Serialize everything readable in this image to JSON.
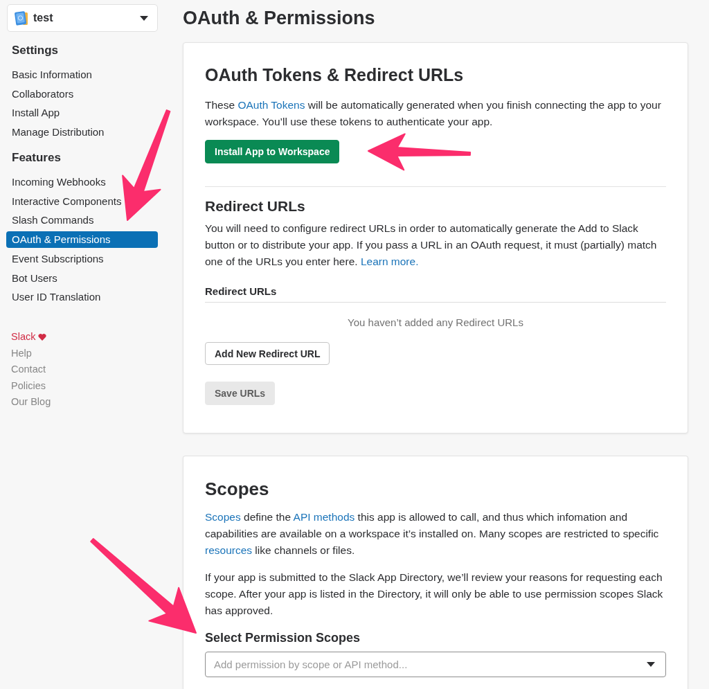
{
  "app_selector": {
    "name": "test"
  },
  "sidebar": {
    "sections": [
      {
        "heading": "Settings",
        "items": [
          {
            "label": "Basic Information",
            "selected": false
          },
          {
            "label": "Collaborators",
            "selected": false
          },
          {
            "label": "Install App",
            "selected": false
          },
          {
            "label": "Manage Distribution",
            "selected": false
          }
        ]
      },
      {
        "heading": "Features",
        "items": [
          {
            "label": "Incoming Webhooks",
            "selected": false
          },
          {
            "label": "Interactive Components",
            "selected": false
          },
          {
            "label": "Slash Commands",
            "selected": false
          },
          {
            "label": "OAuth & Permissions",
            "selected": true
          },
          {
            "label": "Event Subscriptions",
            "selected": false
          },
          {
            "label": "Bot Users",
            "selected": false
          },
          {
            "label": "User ID Translation",
            "selected": false
          }
        ]
      }
    ],
    "footer_links": [
      {
        "label": "Slack",
        "kind": "brand"
      },
      {
        "label": "Help",
        "kind": "link"
      },
      {
        "label": "Contact",
        "kind": "link"
      },
      {
        "label": "Policies",
        "kind": "link"
      },
      {
        "label": "Our Blog",
        "kind": "link"
      }
    ]
  },
  "page_title": "OAuth & Permissions",
  "oauth_card": {
    "title": "OAuth Tokens & Redirect URLs",
    "description": [
      {
        "kind": "text",
        "text": "These "
      },
      {
        "kind": "link",
        "text": "OAuth Tokens"
      },
      {
        "kind": "text",
        "text": " will be automatically generated when you finish connecting the app to your workspace. You’ll use these tokens to authenticate your app."
      }
    ],
    "install_button": {
      "label": "Install App to Workspace",
      "kind": "primary",
      "disabled": false
    },
    "redirect_section": {
      "title": "Redirect URLs",
      "description": [
        {
          "kind": "text",
          "text": "You will need to configure redirect URLs in order to automatically generate the Add to Slack button or to distribute your app. If you pass a URL in an OAuth request, it must (partially) match one of the URLs you enter here. "
        },
        {
          "kind": "link",
          "text": "Learn more."
        }
      ],
      "list_heading": "Redirect URLs",
      "empty_message": "You haven’t added any Redirect URLs",
      "add_button": {
        "label": "Add New Redirect URL",
        "kind": "outline",
        "disabled": false
      },
      "save_button": {
        "label": "Save URLs",
        "kind": "plain",
        "disabled": true
      }
    }
  },
  "scopes_card": {
    "title": "Scopes",
    "paragraphs": [
      [
        {
          "kind": "link",
          "text": "Scopes"
        },
        {
          "kind": "text",
          "text": " define the "
        },
        {
          "kind": "link",
          "text": "API methods"
        },
        {
          "kind": "text",
          "text": " this app is allowed to call, and thus which infomation and capabilities are available on a workspace it’s installed on. Many scopes are restricted to specific "
        },
        {
          "kind": "link",
          "text": "resources"
        },
        {
          "kind": "text",
          "text": " like channels or files."
        }
      ],
      [
        {
          "kind": "text",
          "text": "If your app is submitted to the Slack App Directory, we’ll review your reasons for requesting each scope. After your app is listed in the Directory, it will only be able to use permission scopes Slack has approved."
        }
      ]
    ],
    "select_heading": "Select Permission Scopes",
    "select": {
      "placeholder": "Add permission by scope or API method..."
    }
  }
}
